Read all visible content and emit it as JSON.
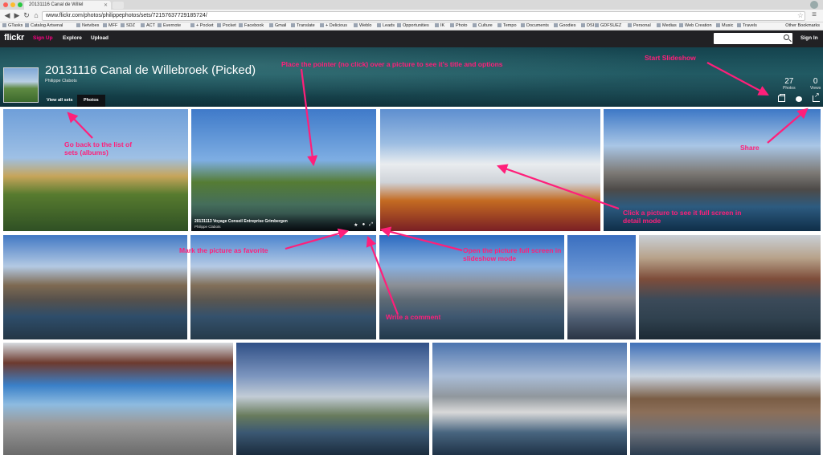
{
  "browser": {
    "tab_title": "20131116 Canal de Willel",
    "url": "www.flickr.com/photos/philippephotos/sets/72157637729185724/",
    "bookmarks": [
      "GTasks",
      "Catalog Artsenal",
      "Netvibes",
      "MFF",
      "SDZ",
      "ACT",
      "Evernote",
      "+ Pocket",
      "Pocket",
      "Facebook",
      "Gmail",
      "Translate",
      "+ Delicious",
      "Weblo",
      "Leads",
      "Opportunities",
      "IK",
      "Photo",
      "Culture",
      "Tempo",
      "Documents",
      "Goodies",
      "DSI",
      "GDFSUEZ",
      "Personal",
      "Medias",
      "Web Creation",
      "Music",
      "Travels"
    ],
    "other_bookmarks": "Other Bookmarks"
  },
  "flickr_nav": {
    "logo": "flickr",
    "signup": "Sign Up",
    "explore": "Explore",
    "upload": "Upload",
    "search_placeholder": "",
    "signin": "Sign In"
  },
  "header": {
    "title": "20131116 Canal de Willebroek (Picked)",
    "author": "Philippe Clabots",
    "tabs": [
      "View all sets",
      "Photos"
    ],
    "photos_count": "27",
    "photos_label": "Photos",
    "views_count": "0",
    "views_label": "Views"
  },
  "hovered_photo": {
    "title": "20131113 Voyage Conseil Entreprise Grimbergen",
    "author": "Philippe Clabots"
  },
  "annotations": {
    "hover": "Place the pointer (no click) over a picture to see it's title and options",
    "slideshow": "Start Slideshow",
    "back": "Go back to the list of sets (albums)",
    "share": "Share",
    "fullscreen": "Click a picture to see it full screen in detail mode",
    "favorite": "Mark the picture as favorite",
    "slideshow_full": "Open the picture full screen in slideshow mode",
    "comment": "Write a comment"
  },
  "colors": {
    "annotation": "#ff1f7a",
    "flickr_pink": "#ff0084",
    "nav_bg": "#212124"
  }
}
